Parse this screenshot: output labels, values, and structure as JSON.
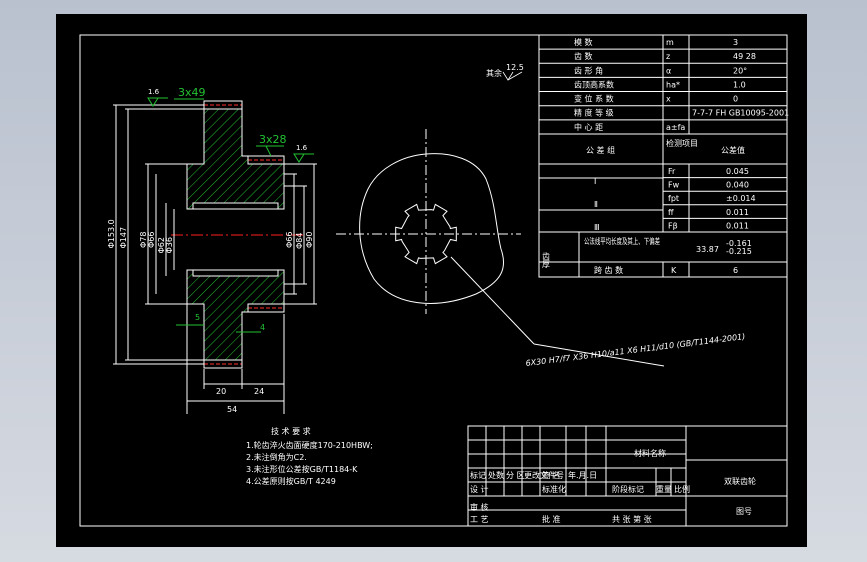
{
  "colors": {
    "background": "#000000",
    "line": "#ffffff",
    "hatch": "#22c232",
    "center": "#ff2020",
    "dim": "#22c232"
  },
  "params": {
    "rows": [
      {
        "name": "模 数",
        "sym": "m",
        "val": "3"
      },
      {
        "name": "齿 数",
        "sym": "z",
        "val": "49   28"
      },
      {
        "name": "齿 形 角",
        "sym": "α",
        "val": "20°"
      },
      {
        "name": "齿顶高系数",
        "sym": "ha*",
        "val": "1.0"
      },
      {
        "name": "变 位 系 数",
        "sym": "x",
        "val": "0"
      },
      {
        "name": "精 度 等 级",
        "sym": "",
        "val": "7-7-7 FH GB10095-2001"
      },
      {
        "name": "中 心 距",
        "sym": "a±fa",
        "val": ""
      }
    ],
    "tol_group_label": "公 差 组",
    "check_item_label": "检测项目",
    "tol_value_label": "公差值",
    "groups": [
      "Ⅰ",
      "Ⅱ",
      "Ⅲ"
    ],
    "tol_rows": [
      {
        "sym": "Fr",
        "val": "0.045"
      },
      {
        "sym": "Fw",
        "val": "0.040"
      },
      {
        "sym": "fpt",
        "val": "±0.014"
      },
      {
        "sym": "ff",
        "val": "0.011"
      },
      {
        "sym": "Fβ",
        "val": "0.011"
      }
    ],
    "tooth_label": "齿厚",
    "tooth_desc": "公法线平均长度及其上、下偏差",
    "tooth_val": "33.87",
    "tooth_tol_up": "-0.161",
    "tooth_tol_low": "-0.215",
    "span_label": "跨 齿 数",
    "span_sym": "K",
    "span_val": "6"
  },
  "dims": {
    "d153": "Φ153.0",
    "d147": "Φ147",
    "d78": "Φ78",
    "d66a": "Φ66",
    "d62": "Φ62",
    "d36": "Φ36",
    "d66b": "Φ66",
    "d84": "Φ84",
    "d90": "Φ90",
    "w20": "20",
    "w24": "24",
    "w54": "54",
    "w5": "5",
    "w4": "4",
    "chamfer1": "3x49",
    "chamfer2": "3x28",
    "rough1": "1.6",
    "rough2": "1.6",
    "rough_rest": "其余",
    "rough_rest_val": "12.5",
    "spline_note": "6X30 H7/f7 X36 H10/a11 X6 H11/d10 (GB/T1144-2001)"
  },
  "tech": {
    "title": "技 术 要 求",
    "items": [
      "1.轮齿淬火齿面硬度170-210HBW;",
      "2.未注倒角为C2.",
      "3.未注形位公差按GB/T1184-K",
      "4.公差原则按GB/T 4249"
    ]
  },
  "titleblock": {
    "material": "材料名称",
    "part_name": "双联齿轮",
    "drawing_no": "图号",
    "row1": [
      "标记",
      "处数",
      "分 区",
      "更改文件号",
      "签 名",
      "年.月.日"
    ],
    "row2": [
      "设 计",
      "",
      "",
      "标准化",
      "",
      "",
      "阶段标记",
      "重量",
      "比例"
    ],
    "row3": [
      "审 核"
    ],
    "row4": [
      "工 艺",
      "",
      "",
      "批 准",
      "",
      "",
      "共 张 第 张"
    ]
  }
}
